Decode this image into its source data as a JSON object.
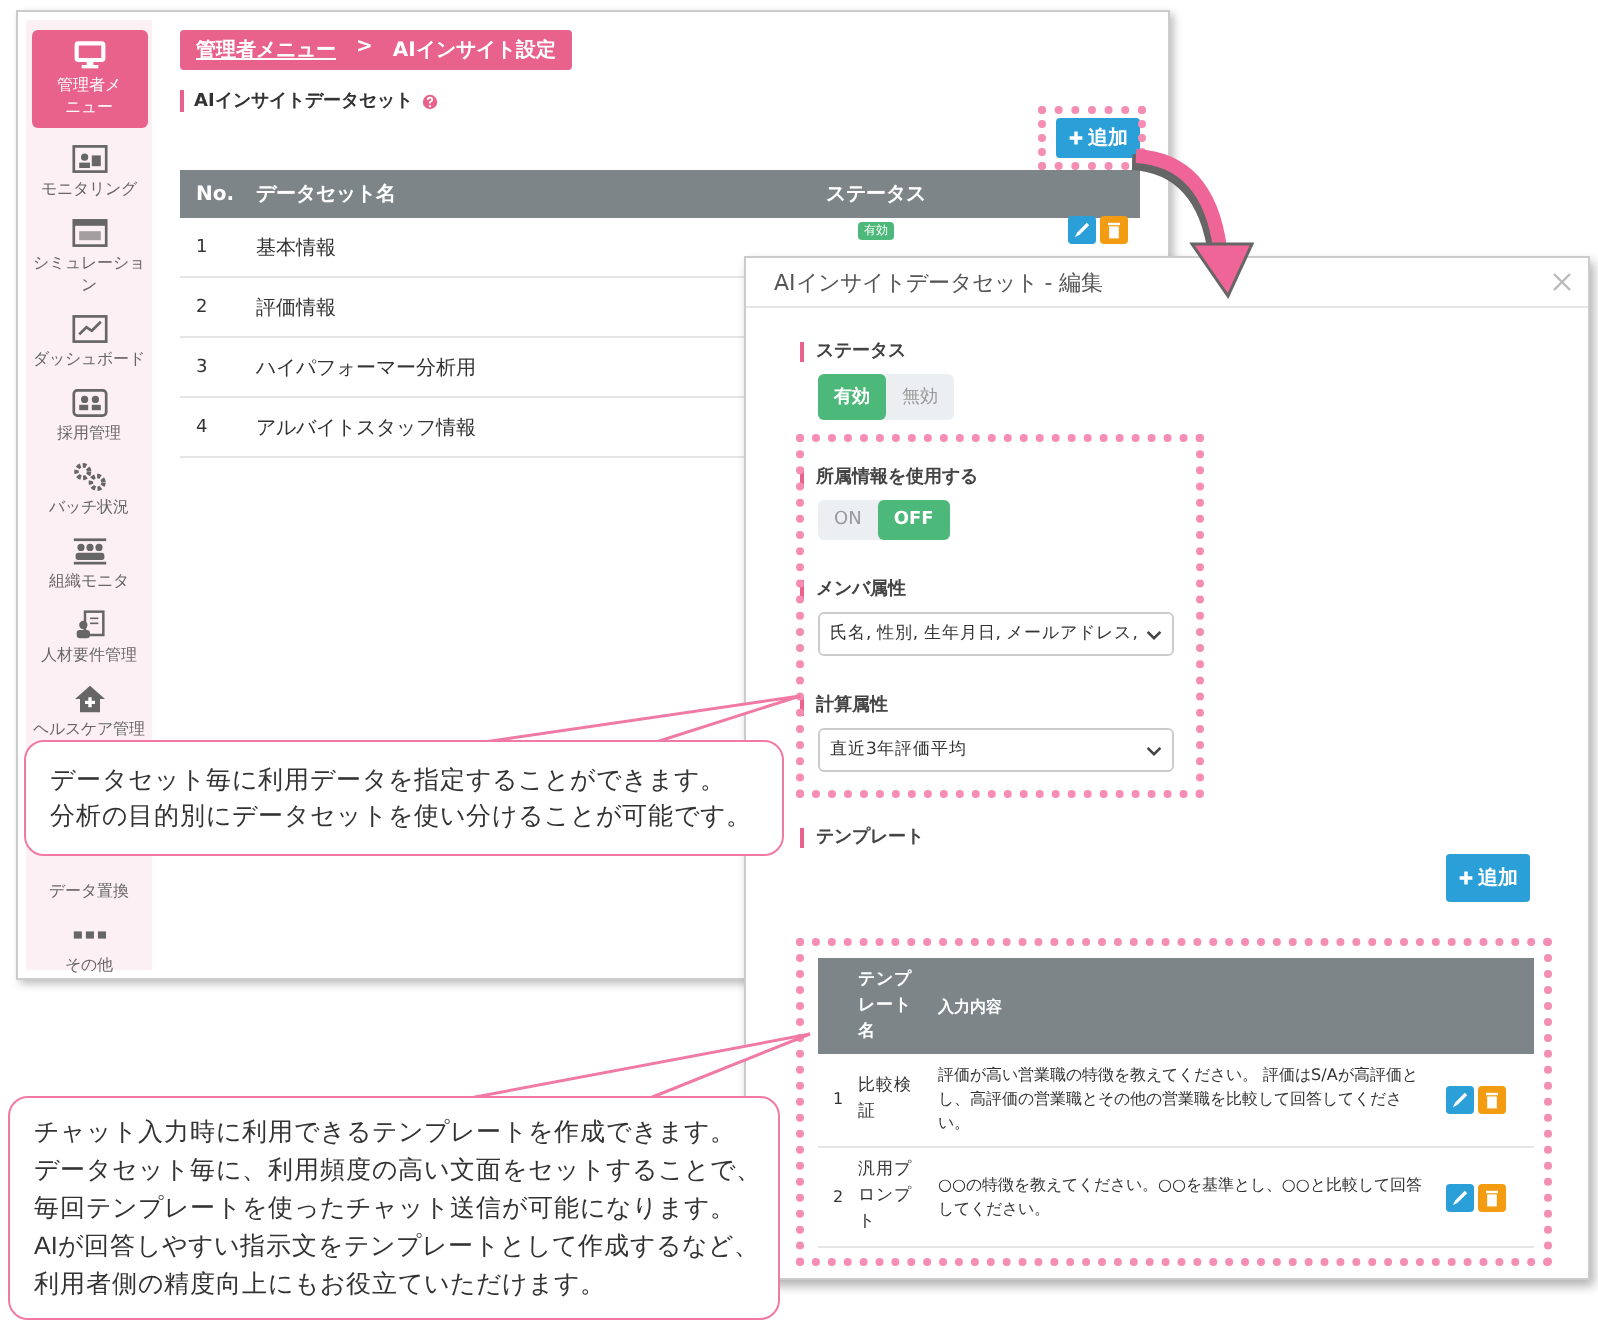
{
  "sidebar": {
    "items": [
      {
        "label": "管理者メニュー",
        "selected": true
      },
      {
        "label": "モニタリング",
        "selected": false
      },
      {
        "label": "シミュレーション",
        "selected": false
      },
      {
        "label": "ダッシュボード",
        "selected": false
      },
      {
        "label": "採用管理",
        "selected": false
      },
      {
        "label": "バッチ状況",
        "selected": false
      },
      {
        "label": "組織モニタ",
        "selected": false
      },
      {
        "label": "人材要件管理",
        "selected": false
      },
      {
        "label": "ヘルスケア管理",
        "selected": false
      },
      {
        "label": "データ置換",
        "selected": false
      },
      {
        "label": "その他",
        "selected": false
      }
    ]
  },
  "breadcrumb": {
    "items": [
      "管理者メニュー",
      "AIインサイト設定"
    ],
    "separator": ">"
  },
  "section_title": "AIインサイトデータセット",
  "add_button": "追加",
  "table": {
    "columns": [
      "No.",
      "データセット名",
      "ステータス"
    ],
    "rows": [
      {
        "no": "1",
        "name": "基本情報",
        "status": "有効"
      },
      {
        "no": "2",
        "name": "評価情報"
      },
      {
        "no": "3",
        "name": "ハイパフォーマー分析用"
      },
      {
        "no": "4",
        "name": "アルバイトスタッフ情報"
      }
    ]
  },
  "modal": {
    "title": "AIインサイトデータセット - 編集",
    "status": {
      "label": "ステータス",
      "options": [
        {
          "label": "有効",
          "selected": true
        },
        {
          "label": "無効",
          "selected": false
        }
      ]
    },
    "affiliation": {
      "label": "所属情報を使用する",
      "options": [
        {
          "label": "ON",
          "selected": false
        },
        {
          "label": "OFF",
          "selected": true
        }
      ]
    },
    "member_attributes": {
      "label": "メンバ属性",
      "value": "氏名, 性別, 生年月日, メールアドレス,"
    },
    "calc_attributes": {
      "label": "計算属性",
      "value": "直近3年評価平均"
    },
    "template": {
      "label": "テンプレート",
      "add_button": "追加",
      "columns": [
        "テンプレート名",
        "入力内容"
      ],
      "rows": [
        {
          "no": "1",
          "name": "比較検証",
          "content": "評価が高い営業職の特徴を教えてください。 評価はS/Aが高評価とし、高評価の営業職とその他の営業職を比較して回答してください。"
        },
        {
          "no": "2",
          "name": "汎用プロンプト",
          "content": "○○の特徴を教えてください。○○を基準とし、○○と比較して回答してください。"
        }
      ]
    }
  },
  "callouts": [
    {
      "lines": [
        "データセット毎に利用データを指定することができます。",
        "分析の目的別にデータセットを使い分けることが可能です。"
      ]
    },
    {
      "lines": [
        "チャット入力時に利用できるテンプレートを作成できます。",
        "データセット毎に、利用頻度の高い文面をセットすることで、",
        "毎回テンプレートを使ったチャット送信が可能になります。",
        "AIが回答しやすい指示文をテンプレートとして作成するなど、",
        "利用者側の精度向上にもお役立ていただけます。"
      ]
    }
  ]
}
